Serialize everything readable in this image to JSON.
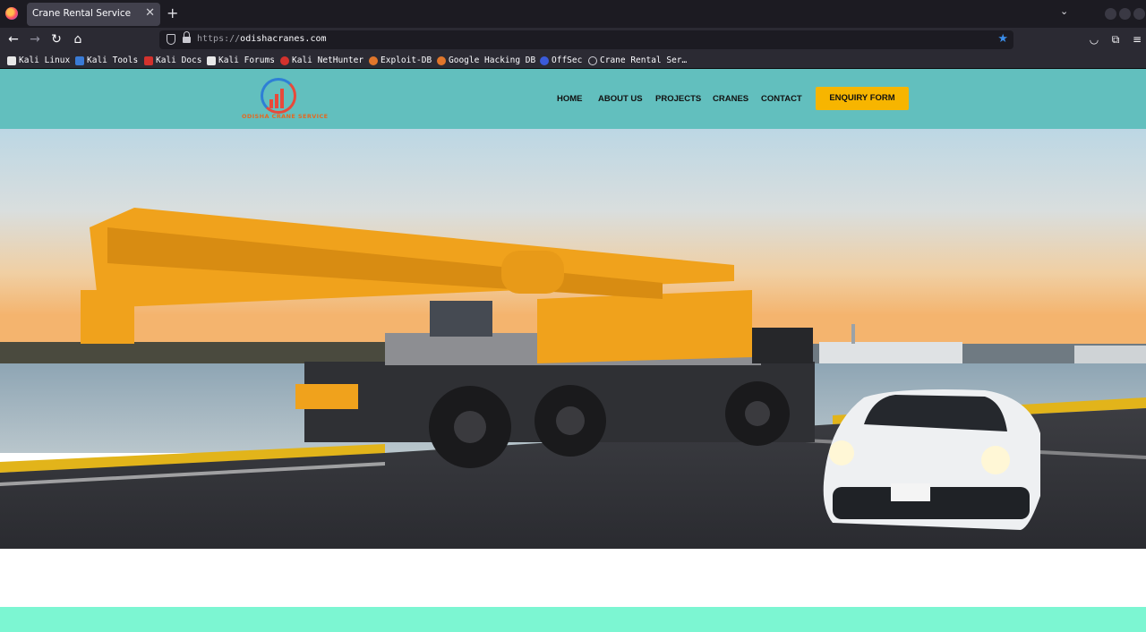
{
  "browser": {
    "tab": {
      "title": "Crane Rental Service",
      "close": "✕"
    },
    "new_tab": "+",
    "url": {
      "scheme": "https://",
      "host": "odishacranes.com"
    },
    "bookmarks": [
      {
        "label": "Kali Linux",
        "icon": "kali-dragon-icon",
        "color": "#e8e8e8"
      },
      {
        "label": "Kali Tools",
        "icon": "kali-tools-icon",
        "color": "#3a7bd5"
      },
      {
        "label": "Kali Docs",
        "icon": "kali-docs-icon",
        "color": "#d2322d"
      },
      {
        "label": "Kali Forums",
        "icon": "kali-dragon-icon",
        "color": "#e8e8e8"
      },
      {
        "label": "Kali NetHunter",
        "icon": "nethunter-icon",
        "color": "#d2322d"
      },
      {
        "label": "Exploit-DB",
        "icon": "exploit-db-icon",
        "color": "#e0762b"
      },
      {
        "label": "Google Hacking DB",
        "icon": "ghdb-icon",
        "color": "#e0762b"
      },
      {
        "label": "OffSec",
        "icon": "offsec-icon",
        "color": "#3a5bd9"
      },
      {
        "label": "Crane Rental Ser…",
        "icon": "globe-icon",
        "color": "#cfcfd6"
      }
    ]
  },
  "site": {
    "logo_text": "ODISHA CRANE SERVICE",
    "nav": [
      "HOME",
      "ABOUT US",
      "PROJECTS",
      "CRANES",
      "CONTACT"
    ],
    "cta": "ENQUIRY FORM",
    "hero": {
      "subject": "Orange all-terrain mobile crane beside a white sports car at a harbour at sunset"
    },
    "colors": {
      "header": "#62bfbe",
      "cta": "#f7b500",
      "footer_band": "#7cf6d2",
      "crane": "#f0a21c"
    }
  }
}
